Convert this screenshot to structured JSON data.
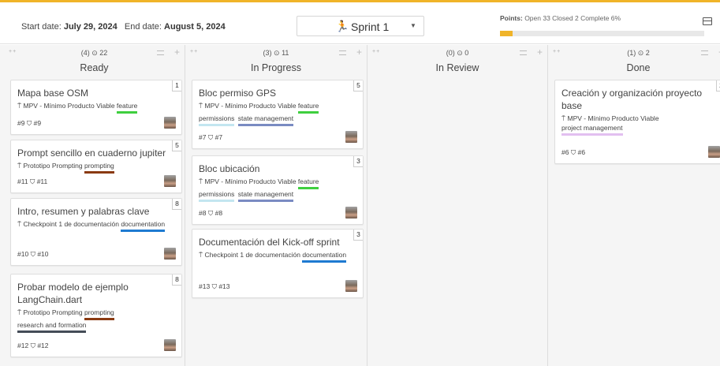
{
  "header": {
    "start_label": "Start date:",
    "start_date": "July 29, 2024",
    "end_label": "End date:",
    "end_date": "August 5, 2024",
    "sprint_icon": "runner-icon",
    "sprint_name": "Sprint 1",
    "points_label": "Points:",
    "points_text": "Open 33 Closed 2 Complete 6%",
    "progress_fraction": 0.06,
    "accent_color": "#f0b429"
  },
  "columns": [
    {
      "count": "(4) ⊙ 22",
      "title": "Ready",
      "cards": [
        {
          "title": "Mapa base OSM",
          "points": "1",
          "milestone": "MPV - Mínimo Producto Viable",
          "labels": [
            {
              "text": "feature",
              "color": "#3ecf3e"
            }
          ],
          "number": "#9",
          "ref": "#9"
        },
        {
          "title": "Prompt sencillo en cuaderno jupiter",
          "points": "5",
          "milestone": "Prototipo Prompting",
          "labels": [
            {
              "text": "prompting",
              "color": "#8a3a12"
            }
          ],
          "number": "#11",
          "ref": "#11"
        },
        {
          "title": "Intro, resumen y palabras clave",
          "points": "8",
          "milestone": "Checkpoint 1 de documentación",
          "labels": [
            {
              "text": "documentation",
              "color": "#1e7ad1"
            }
          ],
          "number": "#10",
          "ref": "#10"
        },
        {
          "title": "Probar modelo de ejemplo LangChain.dart",
          "points": "8",
          "milestone": "Prototipo Prompting",
          "labels": [
            {
              "text": "prompting",
              "color": "#8a3a12"
            },
            {
              "text": "research and formation",
              "color": "#444c57"
            }
          ],
          "number": "#12",
          "ref": "#12"
        }
      ]
    },
    {
      "count": "(3) ⊙ 11",
      "title": "In Progress",
      "cards": [
        {
          "title": "Bloc permiso GPS",
          "points": "5",
          "milestone": "MPV - Mínimo Producto Viable",
          "labels": [
            {
              "text": "feature",
              "color": "#3ecf3e"
            },
            {
              "text": "permissions",
              "color": "#c3e6f0"
            },
            {
              "text": "state management",
              "color": "#7a8bc2"
            }
          ],
          "number": "#7",
          "ref": "#7"
        },
        {
          "title": "Bloc ubicación",
          "points": "3",
          "milestone": "MPV - Mínimo Producto Viable",
          "labels": [
            {
              "text": "feature",
              "color": "#3ecf3e"
            },
            {
              "text": "permissions",
              "color": "#c3e6f0"
            },
            {
              "text": "state management",
              "color": "#7a8bc2"
            }
          ],
          "number": "#8",
          "ref": "#8"
        },
        {
          "title": "Documentación del Kick-off sprint",
          "points": "3",
          "milestone": "Checkpoint 1 de documentación",
          "labels": [
            {
              "text": "documentation",
              "color": "#1e7ad1"
            }
          ],
          "number": "#13",
          "ref": "#13"
        }
      ]
    },
    {
      "count": "(0) ⊙ 0",
      "title": "In Review",
      "cards": []
    },
    {
      "count": "(1) ⊙ 2",
      "title": "Done",
      "cards": [
        {
          "title": "Creación y organización proyecto base",
          "points": "2",
          "milestone": "MPV - Mínimo Producto Viable",
          "labels": [
            {
              "text": "project management",
              "color": "#e2bff0"
            }
          ],
          "number": "#6",
          "ref": "#6"
        }
      ]
    }
  ],
  "icons": {
    "drag": "drag-handle-icon",
    "sort": "sort-icon",
    "add": "add-icon",
    "milestone": "milestone-icon",
    "pr": "pull-request-icon",
    "collapse": "collapse-icon"
  }
}
